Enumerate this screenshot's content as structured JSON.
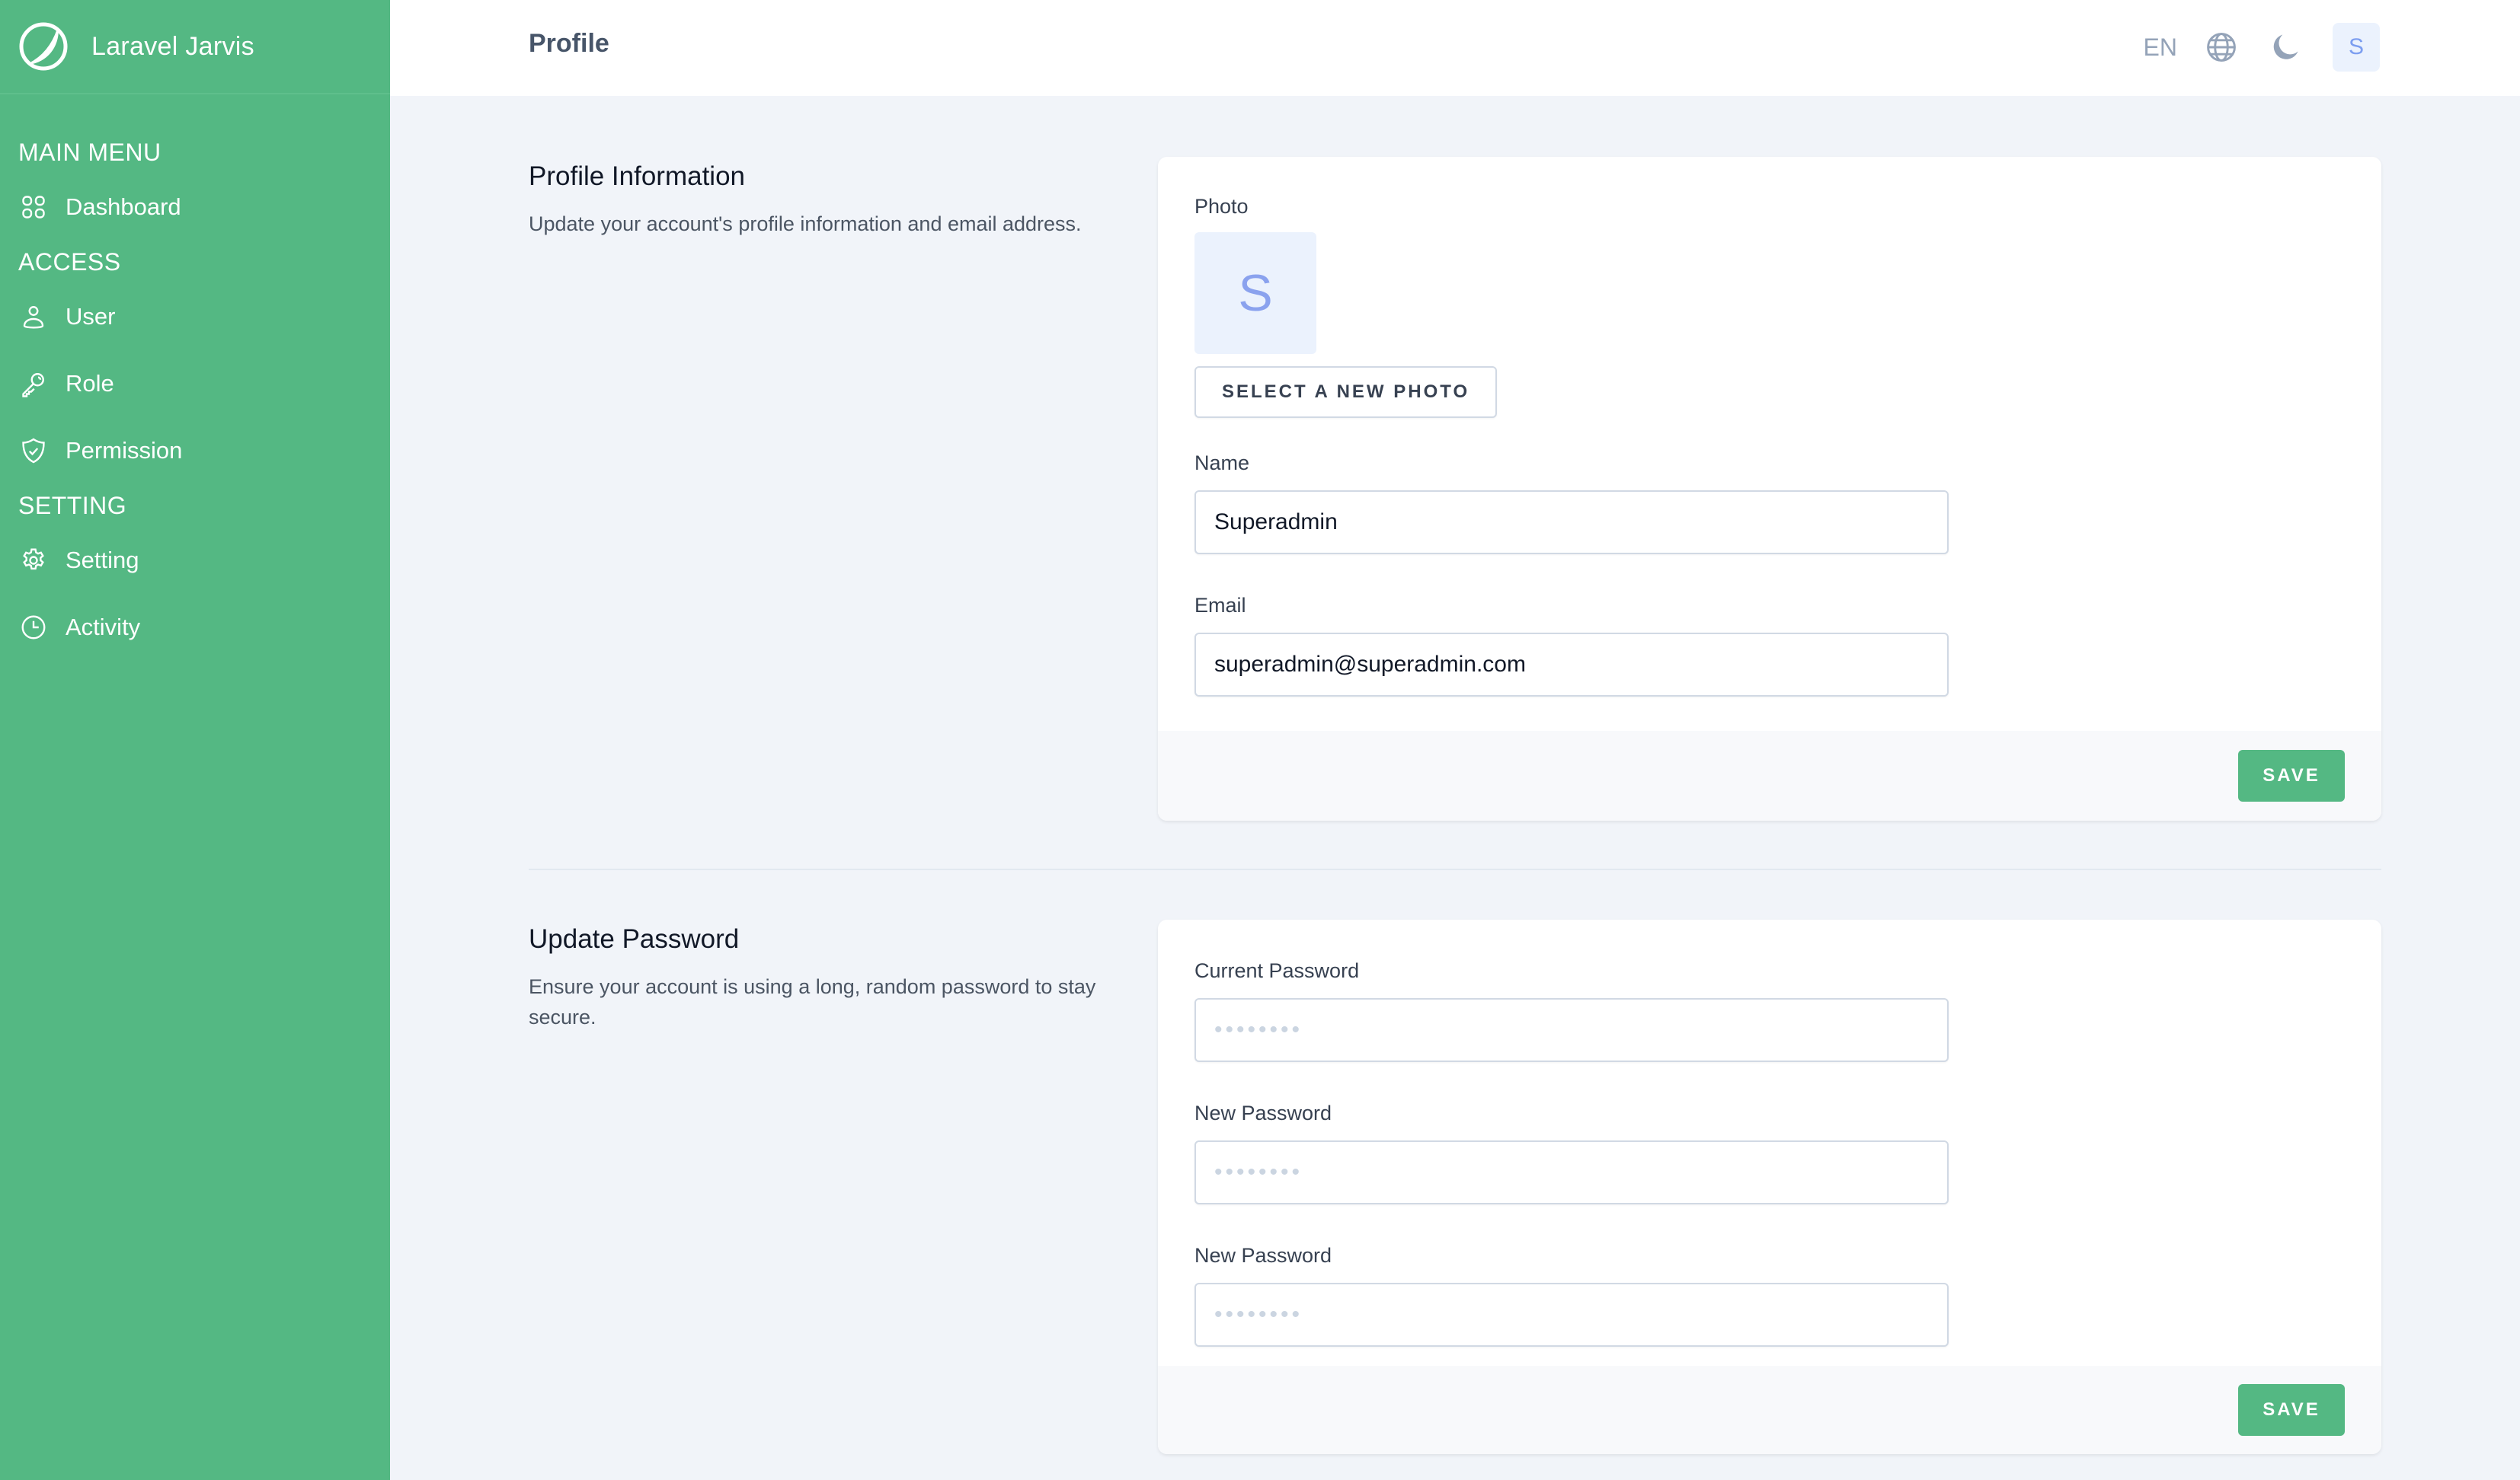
{
  "app": {
    "name": "Laravel Jarvis",
    "logo_icon": "circle-swoosh-logo"
  },
  "sidebar": {
    "sections": [
      {
        "title": "MAIN MENU",
        "items": [
          {
            "label": "Dashboard",
            "icon": "grid-icon"
          }
        ]
      },
      {
        "title": "ACCESS",
        "items": [
          {
            "label": "User",
            "icon": "user-icon"
          },
          {
            "label": "Role",
            "icon": "key-icon"
          },
          {
            "label": "Permission",
            "icon": "shield-check-icon"
          }
        ]
      },
      {
        "title": "SETTING",
        "items": [
          {
            "label": "Setting",
            "icon": "gear-icon"
          },
          {
            "label": "Activity",
            "icon": "clock-icon"
          }
        ]
      }
    ]
  },
  "header": {
    "title": "Profile",
    "language": "EN",
    "language_icon": "globe-icon",
    "theme_icon": "moon-icon",
    "avatar_initial": "S"
  },
  "profile_info": {
    "title": "Profile Information",
    "description": "Update your account's profile information and email address.",
    "photo_label": "Photo",
    "photo_initial": "S",
    "select_photo_label": "SELECT A NEW PHOTO",
    "name_label": "Name",
    "name_value": "Superadmin",
    "email_label": "Email",
    "email_value": "superadmin@superadmin.com",
    "save_label": "SAVE"
  },
  "update_password": {
    "title": "Update Password",
    "description": "Ensure your account is using a long, random password to stay secure.",
    "current_password_label": "Current Password",
    "current_password_placeholder": "••••••••",
    "new_password_label": "New Password",
    "new_password_placeholder": "••••••••",
    "confirm_password_label": "New Password",
    "confirm_password_placeholder": "••••••••",
    "save_label": "SAVE"
  },
  "colors": {
    "brand": "#54b883",
    "background": "#f1f4f9",
    "avatar_bg": "#ebf2fd",
    "avatar_text": "#7c9ef0"
  }
}
